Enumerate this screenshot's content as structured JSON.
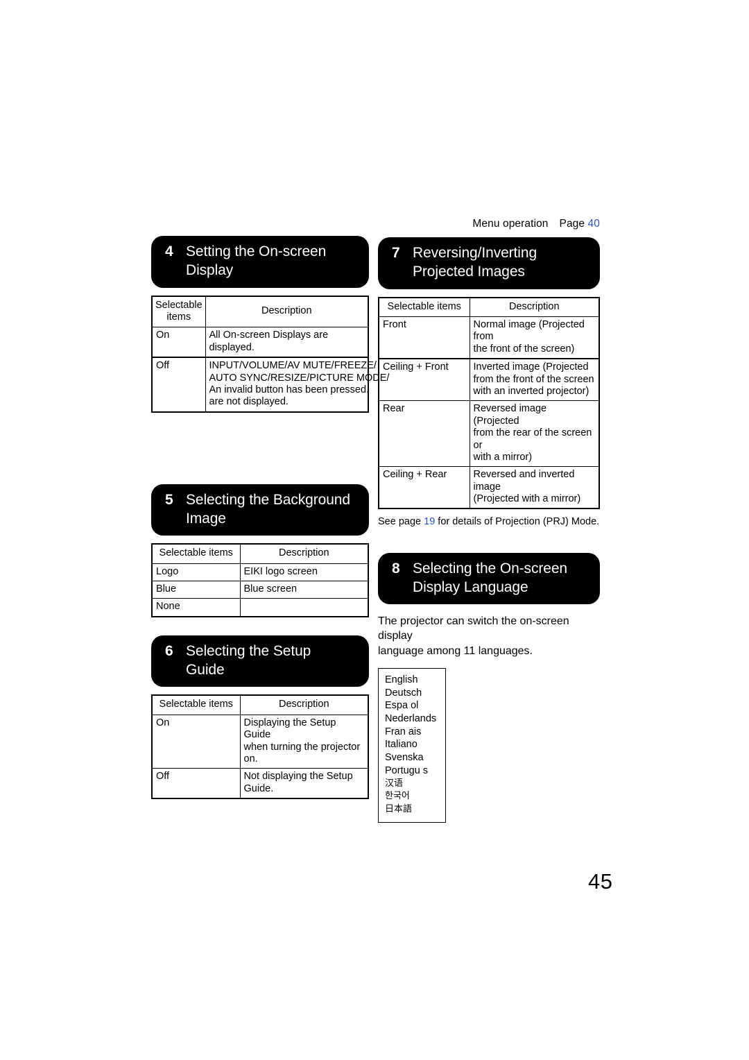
{
  "header": {
    "label": "Menu operation",
    "page_label": "Page",
    "page_number": "40"
  },
  "folio": "45",
  "sections": {
    "s4": {
      "number": "4",
      "title_line1": "Setting the On-screen",
      "title_line2": "Display",
      "table": {
        "col1_header_line1": "Selectable",
        "col1_header_line2": "items",
        "col2_header": "Description",
        "rows": [
          {
            "item": "On",
            "desc": "All On-screen Displays are displayed."
          },
          {
            "item": "Off",
            "desc_line1": "INPUT/VOLUME/AV MUTE/FREEZE/",
            "desc_line2": "AUTO SYNC/RESIZE/PICTURE MODE/",
            "desc_line3": " An invalid button has been pressed.",
            "desc_line4": "are not displayed."
          }
        ]
      }
    },
    "s5": {
      "number": "5",
      "title_line1": "Selecting the Background",
      "title_line2": "Image",
      "table": {
        "col1_header": "Selectable items",
        "col2_header": "Description",
        "rows": [
          {
            "item": "Logo",
            "desc": "EIKI logo screen"
          },
          {
            "item": "Blue",
            "desc": "Blue screen"
          },
          {
            "item": "None",
            "desc": ""
          }
        ]
      }
    },
    "s6": {
      "number": "6",
      "title_line1": "Selecting the Setup",
      "title_line2": "Guide",
      "table": {
        "col1_header": "Selectable items",
        "col2_header": "Description",
        "rows": [
          {
            "item": "On",
            "desc_line1": "Displaying the Setup Guide",
            "desc_line2": "when turning the projector on."
          },
          {
            "item": "Off",
            "desc_line1": "Not displaying the Setup",
            "desc_line2": "Guide."
          }
        ]
      }
    },
    "s7": {
      "number": "7",
      "title_line1": "Reversing/Inverting",
      "title_line2": "Projected Images",
      "table": {
        "col1_header": "Selectable items",
        "col2_header": "Description",
        "rows": [
          {
            "item": "Front",
            "desc_line1": "Normal image (Projected from",
            "desc_line2": "the front of the screen)",
            "desc_line3": ""
          },
          {
            "item": "Ceiling + Front",
            "desc_line1": "Inverted image (Projected",
            "desc_line2": "from the front of the screen",
            "desc_line3": "with an inverted projector)"
          },
          {
            "item": "Rear",
            "desc_line1": "Reversed image (Projected",
            "desc_line2": "from the rear of the screen or",
            "desc_line3": "with a mirror)"
          },
          {
            "item": "Ceiling + Rear",
            "desc_line1": "Reversed and inverted image",
            "desc_line2": "(Projected with a mirror)",
            "desc_line3": ""
          }
        ]
      },
      "note": {
        "prefix": "See page ",
        "page_number": "19",
        "suffix": " for details of Projection (PRJ) Mode."
      }
    },
    "s8": {
      "number": "8",
      "title_line1": "Selecting the On-screen",
      "title_line2": "Display Language",
      "paragraph_line1": "The projector can switch the on-screen display",
      "paragraph_line2": "language among 11 languages.",
      "languages": [
        "English",
        "Deutsch",
        "Espa ol",
        "Nederlands",
        "Fran ais",
        "Italiano",
        "Svenska",
        "Portugu s",
        "汉语",
        "한국어",
        "日本語"
      ]
    }
  },
  "colors": {
    "page_reference": "#2b4fd8",
    "banner_background": "#000000",
    "banner_text": "#ffffff"
  }
}
